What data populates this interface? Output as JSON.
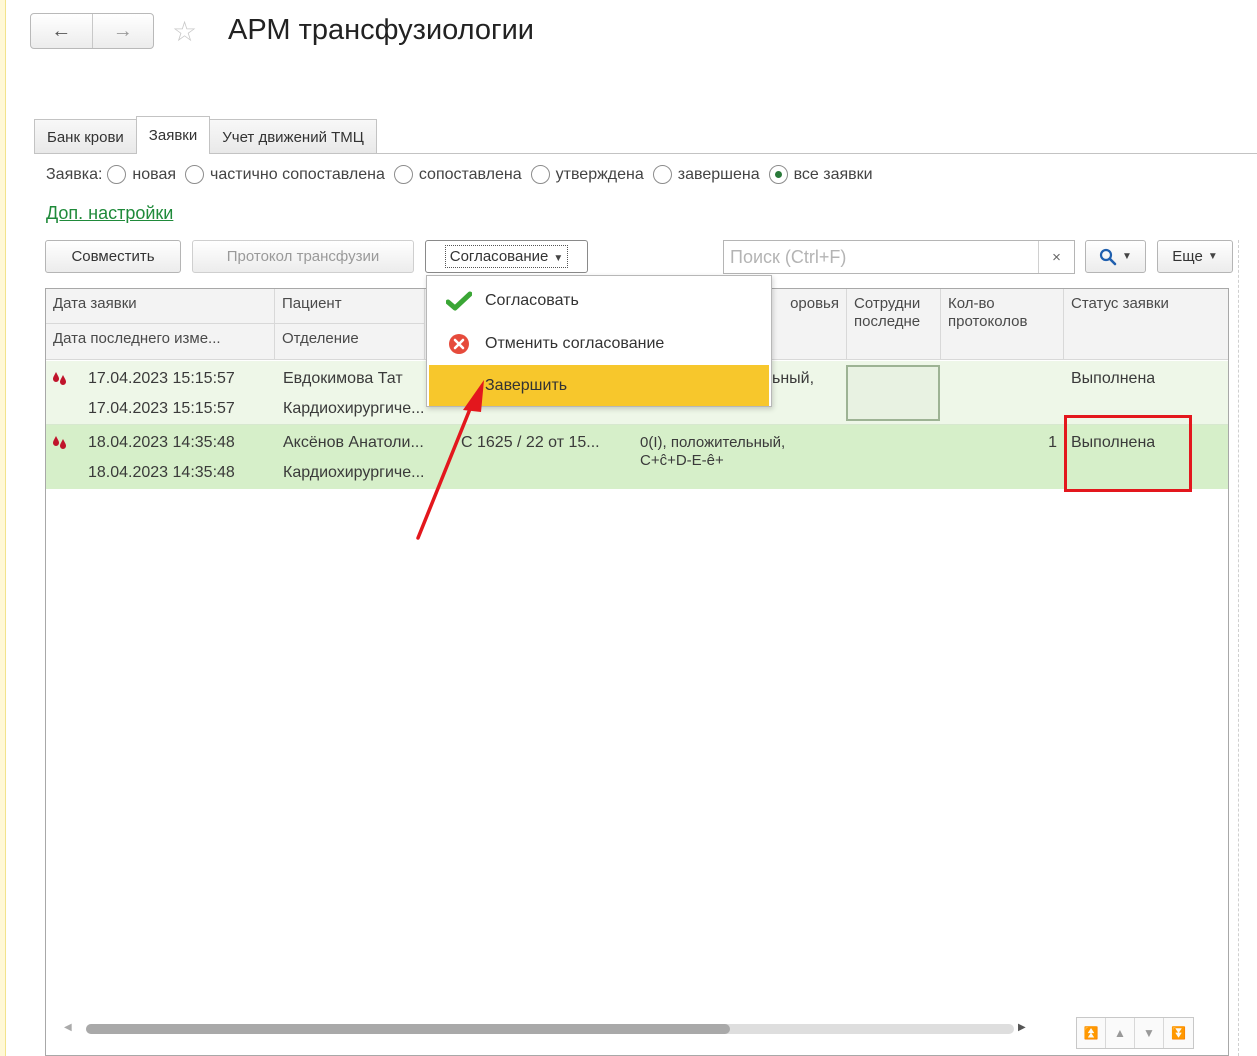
{
  "window": {
    "title": "АРМ трансфузиологии",
    "back_icon": "←",
    "forward_icon": "→",
    "favorite_icon": "☆"
  },
  "tabs": [
    {
      "label": "Банк крови",
      "active": false
    },
    {
      "label": "Заявки",
      "active": true
    },
    {
      "label": "Учет движений ТМЦ",
      "active": false
    }
  ],
  "filter": {
    "label": "Заявка:",
    "options": [
      "новая",
      "частично сопоставлена",
      "сопоставлена",
      "утверждена",
      "завершена",
      "все заявки"
    ],
    "selected": "все заявки"
  },
  "extra_settings_link": "Доп. настройки",
  "toolbar": {
    "combine": "Совместить",
    "transfusion_protocol": "Протокол трансфузии",
    "approval": "Согласование",
    "search_placeholder": "Поиск (Ctrl+F)",
    "clear_icon": "×",
    "search_icon": "search-icon",
    "more": "Еще"
  },
  "approval_menu": {
    "approve": "Согласовать",
    "cancel_approval": "Отменить согласование",
    "finish": "Завершить"
  },
  "table": {
    "headers": {
      "request_date": "Дата заявки",
      "last_modified": "Дата последнего изме...",
      "patient": "Пациент",
      "department": "Отделение",
      "health": "оровья",
      "employee_line1": "Сотрудни",
      "employee_line2": "последне",
      "protocols_line1": "Кол-во",
      "protocols_line2": "протоколов",
      "status": "Статус заявки"
    },
    "rows": [
      {
        "request_date": "17.04.2023 15:15:57",
        "last_modified": "17.04.2023 15:15:57",
        "patient": "Евдокимова Тат",
        "department": "Кардиохирургиче...",
        "health": "ьный,",
        "protocols": "",
        "status": "Выполнена"
      },
      {
        "request_date": "18.04.2023 14:35:48",
        "last_modified": "18.04.2023 14:35:48",
        "patient": "Аксёнов Анатоли...",
        "department": "Кардиохирургиче...",
        "request": "С 1625 / 22 от 15...",
        "health_line1": "0(I), положительный,",
        "health_line2": "C+ĉ+D-E-ê+",
        "protocols": "1",
        "status": "Выполнена"
      }
    ]
  },
  "colors": {
    "accent_yellow": "#f7c72c",
    "row_highlight": "#d6efc9",
    "annotation_red": "#e3171d",
    "link_green": "#1f8a3a"
  }
}
